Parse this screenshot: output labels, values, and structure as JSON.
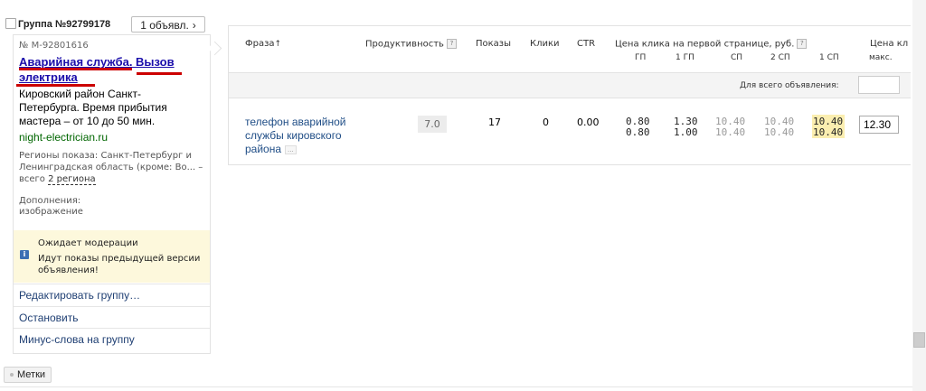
{
  "group": {
    "title": "Группа №92799178",
    "ads_button_label": "1 объявл.",
    "ads_button_chevron": "›"
  },
  "ad": {
    "number": "№ M-92801616",
    "title_line1": "Аварийная служба. Вызов",
    "title_line2": "электрика",
    "text": "Кировский район Санкт-Петербурга. Время прибытия мастера – от 10 до 50 мин.",
    "url": "night-electrician.ru",
    "regions_prefix": "Регионы показа: Санкт-Петербург и Ленинградская область (кроме: Во... – всего",
    "regions_link": "2 региона",
    "extras_label": "Дополнения:",
    "extras_value": "изображение"
  },
  "moderation": {
    "title": "Ожидает модерации",
    "text": "Идут показы предыдущей версии объявления!",
    "icon": "info-icon",
    "icon_glyph": "i"
  },
  "actions": [
    {
      "label": "Редактировать группу…"
    },
    {
      "label": "Остановить"
    },
    {
      "label": "Минус-слова на группу"
    }
  ],
  "tags_label": "Метки",
  "table": {
    "headers": {
      "phrase": "Фраза",
      "phrase_sort": "↑",
      "productivity": "Продуктивность",
      "shows": "Показы",
      "clicks": "Клики",
      "ctr": "CTR",
      "price": "Цена клика на первой странице, руб.",
      "price_sub": [
        "ГП",
        "1 ГП",
        "СП",
        "2 СП",
        "1 СП"
      ],
      "price_cut": "Цена кл",
      "price_cut_sub": "макс.",
      "help_glyph": "?"
    },
    "all_label": "Для всего объявления:",
    "row": {
      "phrase": "телефон аварийной службы кировского района",
      "phrase_more": "...",
      "productivity": "7.0",
      "shows": "17",
      "clicks": "0",
      "ctr": "0.00",
      "gp": [
        "0.80",
        "0.80"
      ],
      "gp1": [
        "1.30",
        "1.00"
      ],
      "sp": [
        "10.40",
        "10.40"
      ],
      "sp2": [
        "10.40",
        "10.40"
      ],
      "sp1": [
        "10.40",
        "10.40"
      ],
      "bid": "12.30"
    }
  },
  "colors": {
    "link": "#1a0dab",
    "url_green": "#006600",
    "moderation_bg": "#fdf8dc",
    "highlight": "#fbeeb0",
    "underline_red": "#cc0000"
  }
}
